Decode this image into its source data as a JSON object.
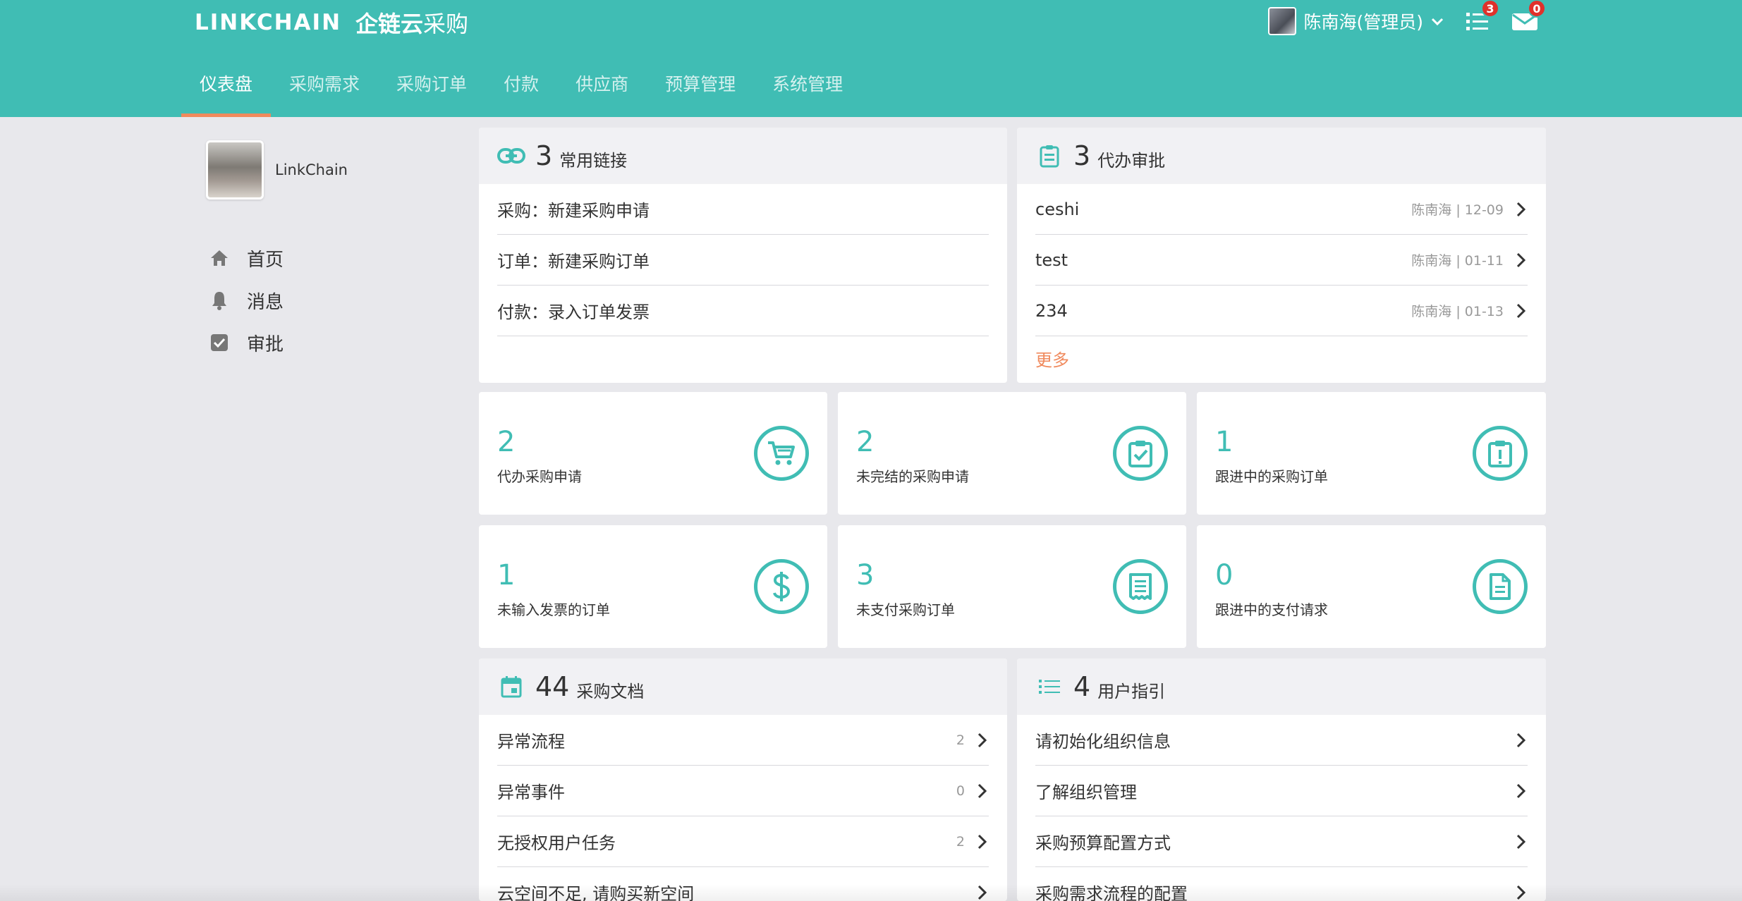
{
  "header": {
    "logo_en": "LINKCHAIN",
    "logo_cn_bold": "企链云",
    "logo_cn_light": "采购",
    "user_name": "陈南海(管理员)",
    "task_badge": "3",
    "mail_badge": "0",
    "accent": "#40bdb4"
  },
  "nav": {
    "tabs": [
      "仪表盘",
      "采购需求",
      "采购订单",
      "付款",
      "供应商",
      "预算管理",
      "系统管理"
    ],
    "active": "仪表盘"
  },
  "sidebar": {
    "profile_name": "LinkChain",
    "items": [
      {
        "label": "首页",
        "icon": "home-icon"
      },
      {
        "label": "消息",
        "icon": "bell-icon"
      },
      {
        "label": "审批",
        "icon": "check-square-icon"
      }
    ]
  },
  "links_panel": {
    "count": "3",
    "title": "常用链接",
    "rows": [
      "采购：新建采购申请",
      "订单：新建采购订单",
      "付款：录入订单发票"
    ]
  },
  "approval_panel": {
    "count": "3",
    "title": "代办审批",
    "rows": [
      {
        "text": "ceshi",
        "meta": "陈南海 | 12-09"
      },
      {
        "text": "test",
        "meta": "陈南海 | 01-11"
      },
      {
        "text": "234",
        "meta": "陈南海 | 01-13"
      }
    ],
    "more": "更多"
  },
  "stats": [
    {
      "num": "2",
      "label": "代办采购申请",
      "icon": "cart-icon"
    },
    {
      "num": "2",
      "label": "未完结的采购申请",
      "icon": "clipboard-check-icon"
    },
    {
      "num": "1",
      "label": "跟进中的采购订单",
      "icon": "clipboard-alert-icon"
    },
    {
      "num": "1",
      "label": "未输入发票的订单",
      "icon": "dollar-icon"
    },
    {
      "num": "3",
      "label": "未支付采购订单",
      "icon": "receipt-icon"
    },
    {
      "num": "0",
      "label": "跟进中的支付请求",
      "icon": "document-icon"
    }
  ],
  "docs_panel": {
    "count": "44",
    "title": "采购文档",
    "rows": [
      {
        "text": "异常流程",
        "meta": "2"
      },
      {
        "text": "异常事件",
        "meta": "0"
      },
      {
        "text": "无授权用户任务",
        "meta": "2"
      },
      {
        "text": "云空间不足, 请购买新空间",
        "meta": ""
      }
    ]
  },
  "guide_panel": {
    "count": "4",
    "title": "用户指引",
    "rows": [
      "请初始化组织信息",
      "了解组织管理",
      "采购预算配置方式",
      "采购需求流程的配置"
    ]
  }
}
